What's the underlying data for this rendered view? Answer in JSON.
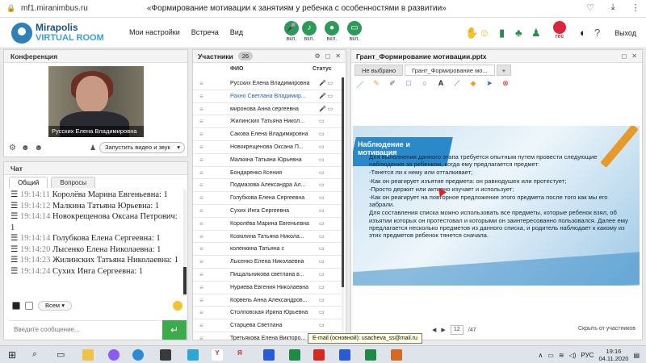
{
  "browser": {
    "url": "mf1.miranimbus.ru",
    "title": "«Формирование мотивации к занятиям у ребенка с особенностями в развитии»"
  },
  "app": {
    "logo_name": "Mirapolis",
    "logo_sub": "VIRTUAL ROOM",
    "menu": [
      "Мои настройки",
      "Встреча",
      "Вид"
    ],
    "media_on_label": "вкл.",
    "rec_label": "rec",
    "exit_label": "Выход"
  },
  "conference": {
    "title": "Конференция",
    "speaker_name": "Русских Елена Владимировна",
    "start_video_label": "Запустить видео и звук"
  },
  "chat": {
    "title": "Чат",
    "tabs": [
      "Общий",
      "Вопросы"
    ],
    "messages": [
      {
        "time": "19:14:11",
        "text": "Королёва Марина Евгеньевна: 1"
      },
      {
        "time": "19:14:12",
        "text": "Малкина Татьяна Юрьевна: 1"
      },
      {
        "time": "19:14:14",
        "text": "Новокрещенова Оксана Петрович: 1"
      },
      {
        "time": "19:14:14",
        "text": "Голубкова Елена Сергеевна: 1"
      },
      {
        "time": "19:14:20",
        "text": "Лысенко Елена Николаевна: 1"
      },
      {
        "time": "19:14:23",
        "text": "Жилинских Татьяна Николаевна: 1"
      },
      {
        "time": "19:14:24",
        "text": "Сухих Инга Сергеевна: 1"
      }
    ],
    "recipient": "Всем",
    "input_placeholder": "Введите сообщение..."
  },
  "participants": {
    "title": "Участники",
    "count": "26",
    "col_name": "ФИО",
    "col_status": "Статус",
    "rows": [
      "Русских Елена Владимировна",
      "Рахно Светлана Владимир...",
      "миронова Анна сергеевна",
      "Жилинских Татьяна Никол...",
      "Сакова Елена Владимировна",
      "Новокрещенова Оксана П...",
      "Малкина Татьяна Юрьевна",
      "Бондаренко Ксения",
      "Подмазова Александра Ал...",
      "Голубкова Елена Сергеевна",
      "Сухих Инга Сергеевна",
      "Королёва Марина Евгеньевна",
      "Козюлина Татьяна Никола...",
      "коленкина Татьяна с",
      "Лысенко Елена Николаевна",
      "Пищальникова светлана в...",
      "Нуриева Евгения Николаевна",
      "Корвель Анна Александров...",
      "Столповская Ирина Юрьевна",
      "Старцева Светлана",
      "Третьякова Елена Викторо..."
    ]
  },
  "presentation": {
    "window_title": "Грант_Формирование мотивации.pptx",
    "tabs": [
      "Не выбрано",
      "Грант_Формирование мо..."
    ],
    "plus": "+",
    "slide_heading": "Наблюдение и мотивация",
    "slide_lines": [
      "Для выполнения данного этапа требуется опытным путем провести следующие наблюдения за ребенком, когда ему предлагается предмет:",
      "-Тянется ли к нему или отталкивает;",
      "-Как он реагирует изъятие предмета: он равнодушен или протестует;",
      "-Просто держит или активно изучает и использует;",
      "-Как он реагирует на повторное предложение этого предмета после того как мы его забрали.",
      "Для составления списка можно использовать все предметы, которые ребенок взял, об изъятии которых он протестовал и которыми он заинтересованно пользовался. Далее ему предлагается несколько предметов из данного списка, и родитель наблюдает к какому из этих предметов ребенок тянется сначала."
    ],
    "page": "12",
    "pages": "/47",
    "hide_label": "Скрыть от участников"
  },
  "tooltip": "E-mail (основной):   usacheva_ss@mail.ru",
  "taskbar": {
    "lang": "РУС",
    "time": "19:16",
    "date": "04.11.2020"
  }
}
